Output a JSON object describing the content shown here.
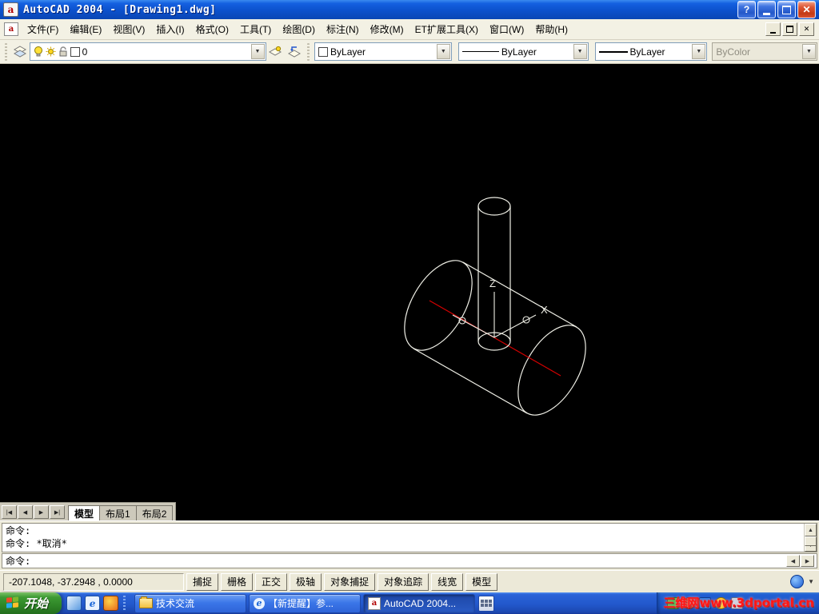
{
  "titlebar": {
    "title": "AutoCAD 2004 - [Drawing1.dwg]"
  },
  "menubar": {
    "items": [
      {
        "label": "文件(F)"
      },
      {
        "label": "编辑(E)"
      },
      {
        "label": "视图(V)"
      },
      {
        "label": "插入(I)"
      },
      {
        "label": "格式(O)"
      },
      {
        "label": "工具(T)"
      },
      {
        "label": "绘图(D)"
      },
      {
        "label": "标注(N)"
      },
      {
        "label": "修改(M)"
      },
      {
        "label": "ET扩展工具(X)"
      },
      {
        "label": "窗口(W)"
      },
      {
        "label": "帮助(H)"
      }
    ]
  },
  "toolbar": {
    "layer_value": "0",
    "color_value": "ByLayer",
    "linetype_value": "ByLayer",
    "lineweight_value": "ByLayer",
    "plotstyle_value": "ByColor"
  },
  "canvas": {
    "ucs_z": "Z",
    "ucs_x": "X"
  },
  "tabs": {
    "model": "模型",
    "layout1": "布局1",
    "layout2": "布局2"
  },
  "command": {
    "history": [
      "命令:",
      "命令: *取消*"
    ],
    "prompt": "命令:"
  },
  "statusbar": {
    "coordinates": "-207.1048, -37.2948 ,  0.0000",
    "toggles": [
      {
        "label": "捕捉"
      },
      {
        "label": "栅格"
      },
      {
        "label": "正交"
      },
      {
        "label": "极轴"
      },
      {
        "label": "对象捕捉"
      },
      {
        "label": "对象追踪"
      },
      {
        "label": "线宽"
      },
      {
        "label": "模型"
      }
    ]
  },
  "taskbar": {
    "start_label": "开始",
    "tasks": [
      {
        "label": "技术交流"
      },
      {
        "label": "【新提醒】参..."
      },
      {
        "label": "AutoCAD 2004..."
      }
    ],
    "watermark": "三维网www.3dportal.cn"
  },
  "glyphs": {
    "acad_letter": "a",
    "ie_letter": "e",
    "help": "?",
    "close": "✕",
    "combo_arrow": "▼",
    "scroll_up": "▲",
    "scroll_down": "▼",
    "scroll_left": "◀",
    "scroll_right": "▶",
    "tab_first": "|◀",
    "tab_prev": "◀",
    "tab_next": "▶",
    "tab_last": "▶|",
    "statusbar_menu": "▼"
  },
  "colors": {
    "titlebar_blue": "#0c51cc",
    "ui_face": "#ece9d8",
    "canvas_background": "#000000",
    "wireframe_line": "#efefe6",
    "centerline_red": "#d40000",
    "taskbar_blue": "#2258cc",
    "start_green": "#2f8627",
    "watermark_red": "#ff1616"
  }
}
